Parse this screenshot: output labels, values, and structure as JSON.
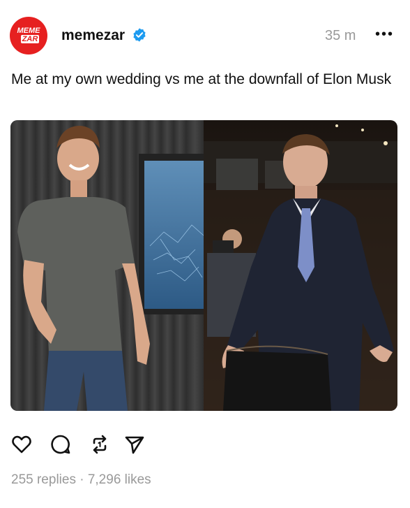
{
  "post": {
    "avatar_text_line1": "MEME",
    "avatar_text_line2": "ZAR",
    "username": "memezar",
    "time": "35 m",
    "more": "•••",
    "caption": "Me at my own wedding vs me at the downfall of Elon Musk",
    "stats": "255 replies · 7,296 likes"
  },
  "icons": {
    "verified": "verified-badge-icon",
    "like": "heart-icon",
    "reply": "comment-icon",
    "repost": "repost-icon",
    "share": "send-icon"
  },
  "colors": {
    "brand": "#e62020",
    "verified": "#1d9bf0",
    "muted": "#999999"
  }
}
